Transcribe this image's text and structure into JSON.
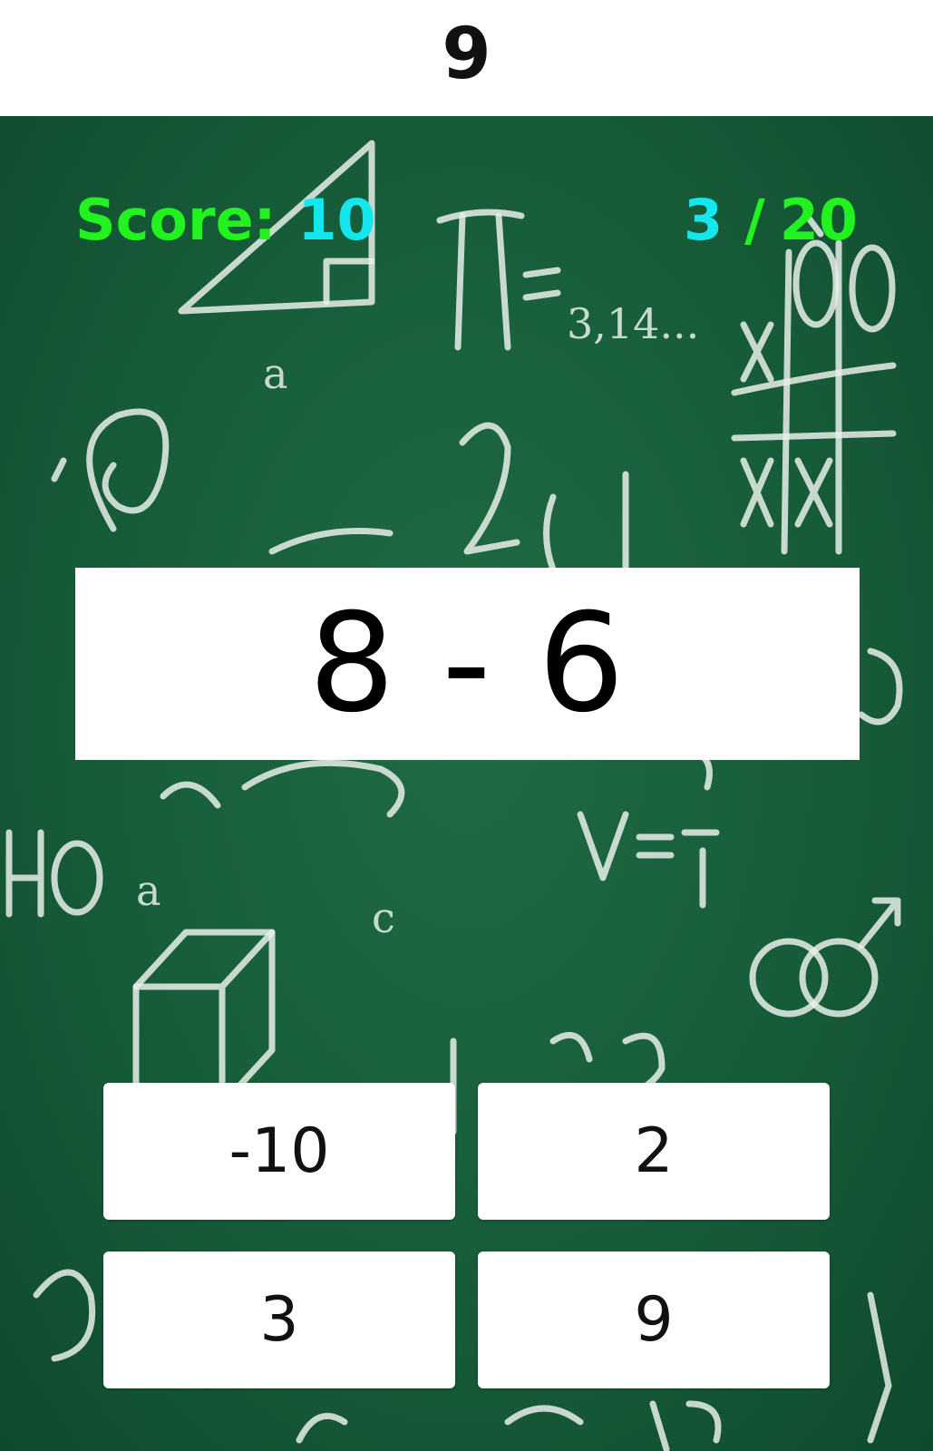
{
  "timer": {
    "value": "9"
  },
  "score": {
    "label": "Score:",
    "value": "10"
  },
  "progress": {
    "current": "3",
    "separator": "/",
    "total": "20"
  },
  "question": {
    "expression": "8 - 6"
  },
  "answers": [
    "-10",
    "2",
    "3",
    "9"
  ],
  "colors": {
    "board": "#175c39",
    "label_green": "#22f21f",
    "value_cyan": "#14e6ee",
    "panel": "#ffffff"
  }
}
